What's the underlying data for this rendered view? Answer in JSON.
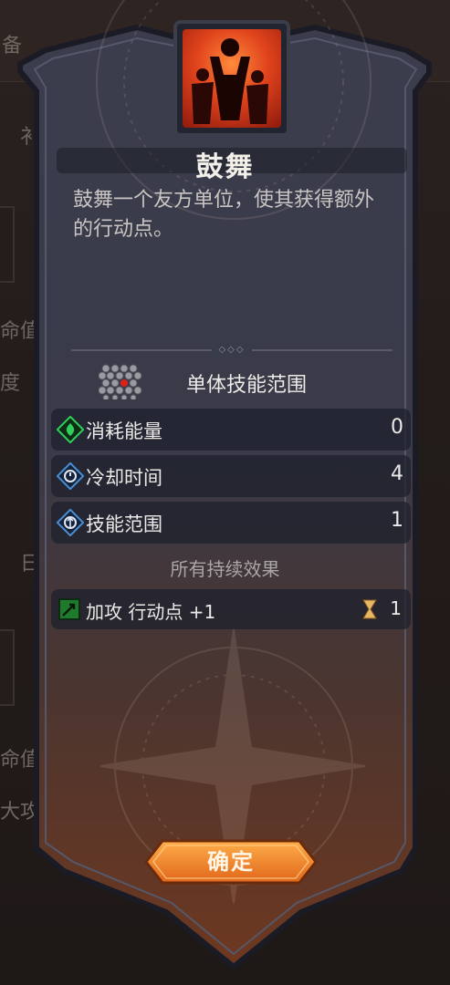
{
  "background": {
    "fragments": [
      "备",
      "衤",
      "命值",
      "度",
      "命值",
      "大攻",
      "日"
    ]
  },
  "skill": {
    "title": "鼓舞",
    "description": "鼓舞一个友方单位，使其获得额外的行动点。",
    "range_label": "单体技能范围"
  },
  "stats": [
    {
      "label": "消耗能量",
      "value": "0",
      "icon": "energy-icon",
      "color": "#2fcf5a"
    },
    {
      "label": "冷却时间",
      "value": "4",
      "icon": "cooldown-icon",
      "color": "#4a8fd4"
    },
    {
      "label": "技能范围",
      "value": "1",
      "icon": "range-icon",
      "color": "#4a8fd4"
    }
  ],
  "effects_title": "所有持续效果",
  "effects": [
    {
      "label": "加攻 行动点 +1",
      "duration": "1",
      "icon": "buff-icon"
    }
  ],
  "confirm_label": "确定",
  "colors": {
    "panel_top": "#3a3c4c",
    "panel_bottom": "#6a3620",
    "accent_orange": "#f08a2c",
    "skill_icon_red": "#e0431c"
  }
}
